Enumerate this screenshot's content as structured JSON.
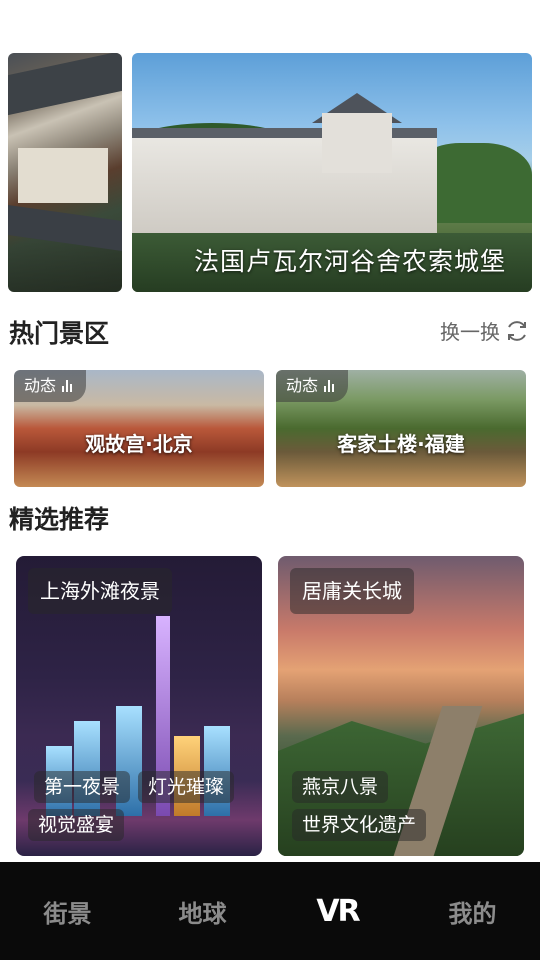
{
  "banner": {
    "caption": "法国卢瓦尔河谷舍农索城堡"
  },
  "hot_section": {
    "title": "热门景区",
    "refresh_label": "换一换",
    "cards": [
      {
        "tag": "动态",
        "name": "观故宫·北京"
      },
      {
        "tag": "动态",
        "name": "客家土楼·福建"
      }
    ]
  },
  "rec_section": {
    "title": "精选推荐",
    "cards": [
      {
        "title": "上海外滩夜景",
        "tags": [
          "第一夜景",
          "灯光璀璨",
          "视觉盛宴"
        ]
      },
      {
        "title": "居庸关长城",
        "tags": [
          "燕京八景",
          "世界文化遗产"
        ]
      }
    ]
  },
  "nav": {
    "items": [
      "街景",
      "地球",
      "VR",
      "我的"
    ]
  }
}
